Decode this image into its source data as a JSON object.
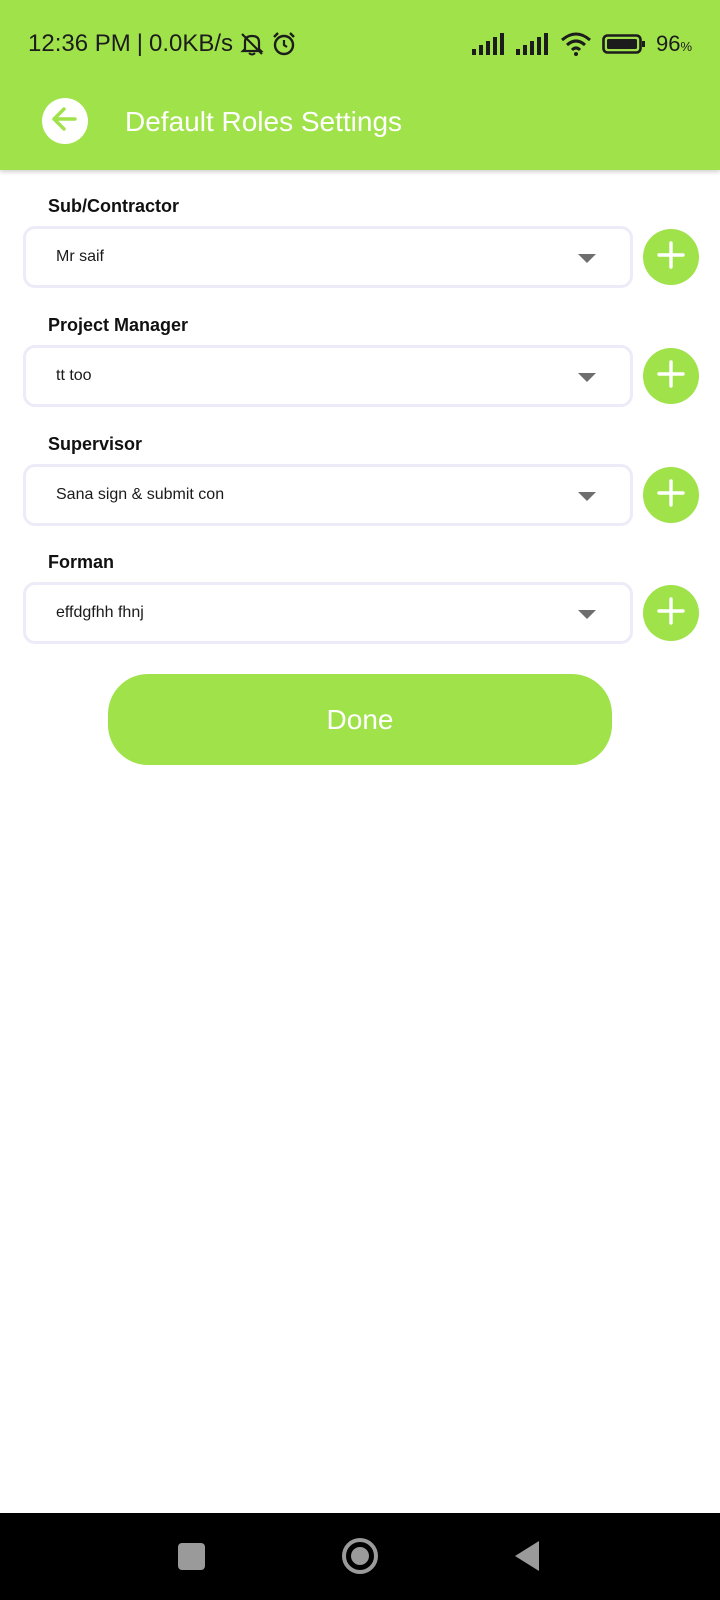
{
  "status": {
    "time": "12:36 PM",
    "separator": "|",
    "speed": "0.0KB/s",
    "battery_value": "96",
    "battery_unit": "%",
    "icons": [
      "bell-off-icon",
      "alarm-icon",
      "signal-icon",
      "signal-icon",
      "wifi-icon",
      "battery-icon"
    ]
  },
  "appbar": {
    "title": "Default Roles Settings",
    "back_icon": "arrow-left-icon"
  },
  "fields": [
    {
      "label": "Sub/Contractor",
      "value": "Mr saif"
    },
    {
      "label": "Project Manager",
      "value": "tt too"
    },
    {
      "label": "Supervisor",
      "value": "Sana sign & submit con"
    },
    {
      "label": "Forman",
      "value": "effdgfhh fhnj"
    }
  ],
  "done_label": "Done",
  "colors": {
    "accent": "#A0E24A",
    "border": "#ECEBF7",
    "navbar": "#000000"
  },
  "navbar": {
    "icons": [
      "recents-square-icon",
      "home-circle-icon",
      "back-triangle-icon"
    ]
  }
}
